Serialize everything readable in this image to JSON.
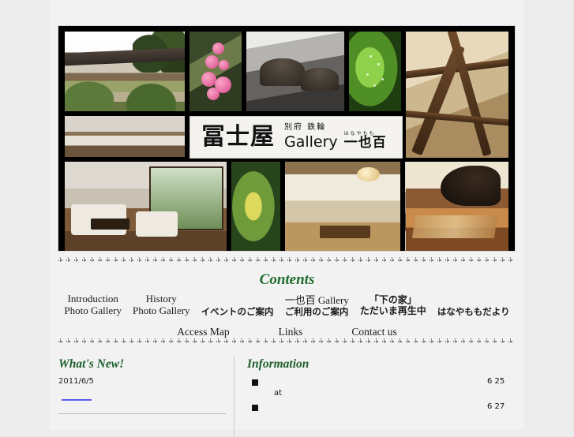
{
  "site": {
    "logo_kanji": "冨士屋",
    "logo_location": "別府 鉄輪",
    "logo_gallery": "Gallery",
    "logo_ruby": "はなやもも",
    "logo_hanayamomo": "一也百"
  },
  "colors": {
    "heading_green": "#1d6b2a",
    "section_green": "#1d5e2b",
    "link_blue": "#5a5aee",
    "page_bg": "#f2f2f2",
    "outer_bg": "#ececec",
    "frame_black": "#000000"
  },
  "contents": {
    "title": "Contents",
    "nav_row1": [
      {
        "line1": "Introduction",
        "line2": "Photo Gallery",
        "style": "en"
      },
      {
        "line1": "History",
        "line2": "Photo Gallery",
        "style": "en"
      },
      {
        "line1": "",
        "line2": "イベントのご案内",
        "style": "jp"
      },
      {
        "line1": "一也百 Gallery",
        "line2": "ご利用のご案内",
        "style": "mixed"
      },
      {
        "line1": "「下の家」",
        "line2": "ただいま再生中",
        "style": "jp-serif"
      },
      {
        "line1": "",
        "line2": "はなやももだより",
        "style": "jp"
      }
    ],
    "nav_row2": [
      {
        "label": "Access Map"
      },
      {
        "label": "Links"
      },
      {
        "label": "Contact us"
      }
    ]
  },
  "whats_new": {
    "title": "What's New!",
    "entries": [
      {
        "date": "2011/6/5",
        "link_label": ""
      }
    ]
  },
  "information": {
    "title": "Information",
    "items": [
      {
        "text": "",
        "date": "6 25",
        "sub": "at"
      },
      {
        "text": "",
        "date": "6 27",
        "sub": ""
      }
    ]
  },
  "header_images": [
    {
      "name": "entrance-garden-photo"
    },
    {
      "name": "plum-blossom-photo"
    },
    {
      "name": "sepia-garden-photo"
    },
    {
      "name": "green-leaf-dew-photo"
    },
    {
      "name": "ceiling-beams-photo"
    },
    {
      "name": "interior-room-photo"
    },
    {
      "name": "lobby-lounge-photo"
    },
    {
      "name": "green-foliage-photo"
    },
    {
      "name": "tatami-room-photo"
    },
    {
      "name": "vintage-family-photo"
    },
    {
      "name": "grand-piano-room-photo"
    }
  ]
}
